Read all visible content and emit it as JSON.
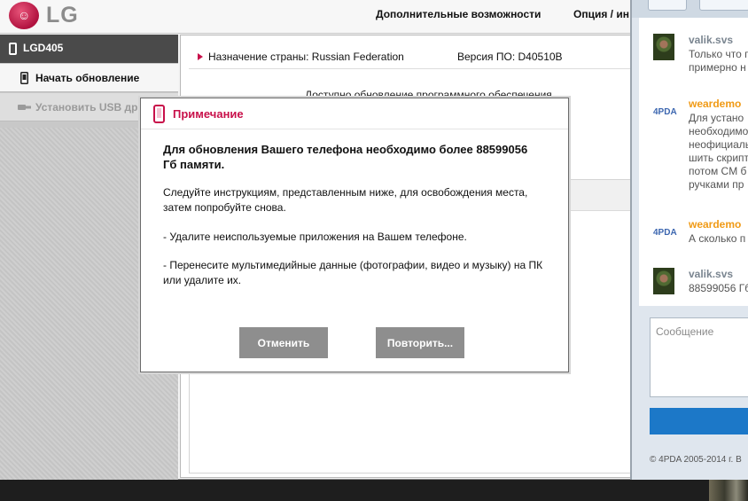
{
  "app": {
    "logo_text": "LG",
    "logo_face": "☺",
    "menu": {
      "extra": "Дополнительные возможности",
      "options": "Опция / ин"
    }
  },
  "sidebar": {
    "device_name": "LGD405",
    "items": [
      {
        "label": "Начать обновление",
        "icon": "phone-icon"
      },
      {
        "label": "Установить USB др",
        "icon": "usb-icon"
      }
    ]
  },
  "main": {
    "country": "Назначение страны: Russian Federation",
    "firmware": "Версия ПО: D40510B",
    "update_text": "Доступно обновление программного обеспечения."
  },
  "dialog": {
    "title": "Примечание",
    "message_bold": "Для обновления Вашего телефона необходимо более 88599056 Гб памяти.",
    "message_follow": "Следуйте инструкциям, представленным ниже, для освобождения места, затем попробуйте снова.",
    "message_remove": "- Удалите неиспользуемые приложения на Вашем телефоне.",
    "message_move": " - Перенесите мультимедийные данные (фотографии, видео и музыку) на ПК или удалите их.",
    "cancel_label": "Отменить",
    "retry_label": "Повторить..."
  },
  "chat": {
    "messages": [
      {
        "author": "valik.svs",
        "lines": [
          "Только что г",
          "примерно н"
        ]
      },
      {
        "author": "weardemo",
        "badge": "4PDA",
        "lines": [
          "Для устано",
          "необходимо",
          "неофициаль",
          "шить скрипт",
          "потом CM б",
          "ручками пр"
        ]
      },
      {
        "author": "weardemo",
        "badge": "4PDA",
        "lines": [
          "А сколько п"
        ]
      },
      {
        "author": "valik.svs",
        "lines": [
          "88599056 Гб"
        ]
      }
    ],
    "input_placeholder": "Сообщение",
    "footer": "© 4PDA 2005-2014 г. В"
  },
  "colors": {
    "accent": "#c8104a",
    "dialog_button": "#8e8e8e",
    "send_button": "#1c78c8",
    "orange_author": "#f09a15"
  }
}
